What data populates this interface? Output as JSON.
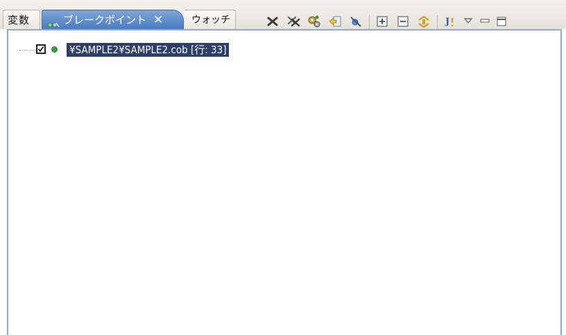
{
  "tabs": [
    {
      "label": "変数"
    },
    {
      "label": "ブレークポイント",
      "close": "✕"
    },
    {
      "label": "ウォッチ"
    }
  ],
  "toolbar": [
    {
      "icon": "remove-breakpoint-icon"
    },
    {
      "icon": "remove-all-breakpoints-icon"
    },
    {
      "icon": "link-with-debug-view-icon"
    },
    {
      "icon": "go-to-file-icon"
    },
    {
      "icon": "skip-all-breakpoints-icon"
    },
    {
      "icon": "expand-all-icon"
    },
    {
      "icon": "collapse-all-icon"
    },
    {
      "icon": "link-icon"
    },
    {
      "icon": "add-java-exception-breakpoint-icon"
    },
    {
      "icon": "view-menu-icon"
    },
    {
      "icon": "minimize-icon"
    },
    {
      "icon": "maximize-icon"
    }
  ],
  "breakpoints": [
    {
      "label": "¥SAMPLE2¥SAMPLE2.cob [行: 33]",
      "checked": true
    }
  ],
  "colors": {
    "active_tab": "#4a7cc0",
    "selection": "#2d3f68",
    "breakpoint_dot": "#3f9c48",
    "frame_border": "#8ea9d6"
  }
}
